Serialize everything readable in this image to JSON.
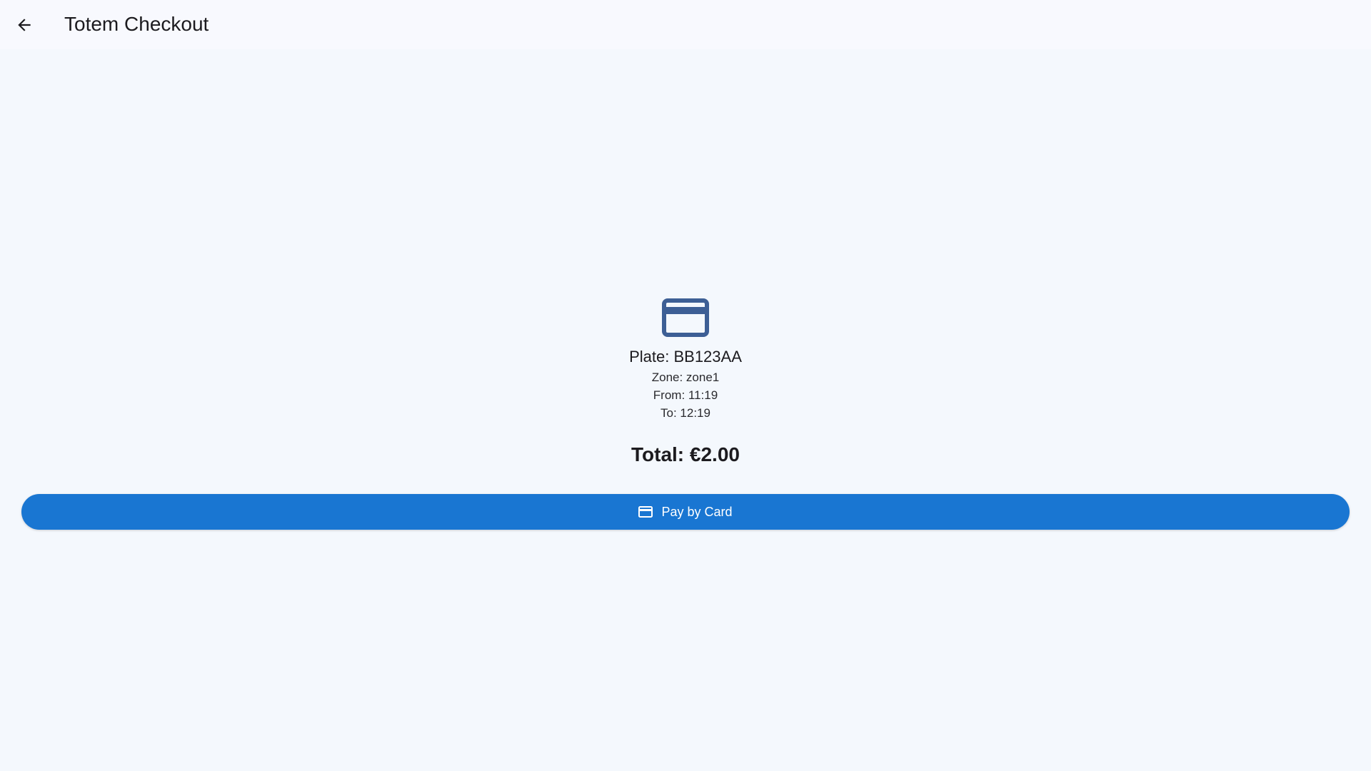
{
  "header": {
    "title": "Totem Checkout",
    "back_icon": "arrow-back-icon"
  },
  "summary": {
    "icon": "credit-card-icon",
    "plate": "Plate: BB123AA",
    "zone": "Zone: zone1",
    "from": "From: 11:19",
    "to": "To: 12:19",
    "total": "Total: €2.00"
  },
  "actions": {
    "pay_label": "Pay by Card",
    "pay_icon": "credit-card-icon"
  },
  "colors": {
    "primary": "#1976d2",
    "icon": "#3d5f95",
    "background": "#f4f8fd",
    "appbar": "#f8f9fe"
  }
}
